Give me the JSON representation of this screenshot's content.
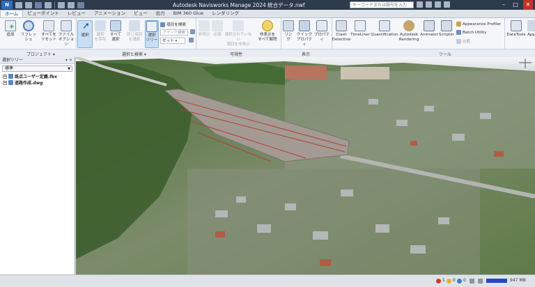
{
  "titlebar": {
    "app_badge": "N",
    "title": "Autodesk Navisworks Manage 2024   統合データ.nwf",
    "search_placeholder": "キーワードまたは語句を入力",
    "min": "–",
    "max": "□",
    "close": "✕"
  },
  "tabs": [
    "ホーム",
    "ビューポイント",
    "レビュー",
    "アニメーション",
    "ビュー",
    "出力",
    "BIM 360 Glue",
    "レンダリング"
  ],
  "ribbon": {
    "project": {
      "append": "追加",
      "refresh": "リフレッシュ",
      "reset_all": "すべてを\nリセット",
      "file_options": "ファイル\nオプション",
      "label": "プロジェクト ▾"
    },
    "select_search": {
      "select": "選択",
      "save_selection": "選択\nを保存",
      "select_all": "すべて\n選択",
      "select_same": "同じ項目\nを選択",
      "selection_tree": "選択\nツリー",
      "find_items": "項目を検索",
      "quick_find": "クイック検索",
      "sets": "セット",
      "label": "選択と検索 ▾"
    },
    "visibility": {
      "hide": "非表示",
      "require": "必須",
      "hide_unselected": "選択されていない\n項目を非表示",
      "unhide_all": "非表示を\nすべて解除",
      "label": "可視性"
    },
    "display": {
      "links": "リンク",
      "quick_properties": "クイック\nプロパティ",
      "properties": "プロパティ",
      "label": "表示"
    },
    "tools": {
      "clash_detective": "Clash\nDetective",
      "timeliner": "TimeLiner",
      "quantification": "Quantification",
      "autodesk_rendering": "Autodesk\nRendering",
      "animator": "Animator",
      "scripter": "Scripter",
      "appearance_profiler": "Appearance Profiler",
      "batch_utility": "Batch Utility",
      "compare": "比較",
      "label": "ツール"
    },
    "datatools": {
      "datatools": "DataTools",
      "app": "App"
    }
  },
  "tree": {
    "title": "選択ツリー",
    "dropdown": "標準",
    "items": [
      "既点ユーザー定義.fbx",
      "道路作成.dwg"
    ]
  },
  "status": {
    "errors": "1",
    "warnings": "0",
    "info": "0",
    "memory": "947 MB"
  },
  "colors": {
    "titlebar": "#2d3a4c",
    "ribbon": "#f4f6f9",
    "accent": "#2b6fc2",
    "road_surface": "#a49a94",
    "road_line": "#b0412e"
  },
  "icons": [
    "append-icon",
    "refresh-icon",
    "reset-icon",
    "options-icon",
    "select-cursor-icon",
    "selection-tree-icon",
    "find-icon",
    "hide-icon",
    "links-icon",
    "quick-props-icon",
    "properties-icon",
    "clash-icon",
    "timeliner-icon",
    "quantification-icon",
    "rendering-icon",
    "animator-icon",
    "scripter-icon",
    "datatools-icon",
    "compass-icon"
  ]
}
